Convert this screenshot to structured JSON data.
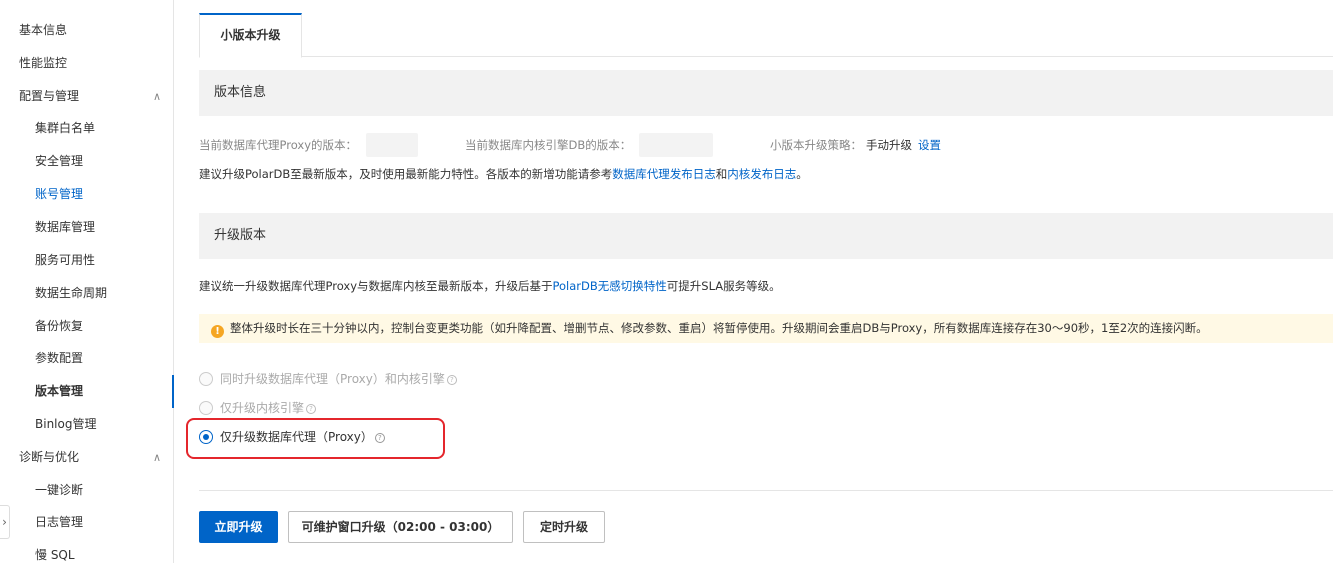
{
  "sidebar": {
    "items": [
      {
        "label": "基本信息",
        "level": "top"
      },
      {
        "label": "性能监控",
        "level": "top"
      },
      {
        "label": "配置与管理",
        "level": "top",
        "expanded": true
      },
      {
        "label": "集群白名单",
        "level": "sub"
      },
      {
        "label": "安全管理",
        "level": "sub"
      },
      {
        "label": "账号管理",
        "level": "sub"
      },
      {
        "label": "数据库管理",
        "level": "sub"
      },
      {
        "label": "服务可用性",
        "level": "sub"
      },
      {
        "label": "数据生命周期",
        "level": "sub"
      },
      {
        "label": "备份恢复",
        "level": "sub"
      },
      {
        "label": "参数配置",
        "level": "sub"
      },
      {
        "label": "版本管理",
        "level": "sub",
        "selected": true
      },
      {
        "label": "Binlog管理",
        "level": "sub"
      },
      {
        "label": "诊断与优化",
        "level": "top",
        "expanded": true
      },
      {
        "label": "一键诊断",
        "level": "sub"
      },
      {
        "label": "日志管理",
        "level": "sub"
      },
      {
        "label": "慢 SQL",
        "level": "sub"
      }
    ],
    "chevron": "∧",
    "collapse_glyph": "›"
  },
  "tabs": [
    {
      "label": "小版本升级",
      "active": true
    }
  ],
  "version_info": {
    "title": "版本信息",
    "proxy_version_label": "当前数据库代理Proxy的版本：",
    "db_version_label": "当前数据库内核引擎DB的版本：",
    "strategy_label": "小版本升级策略：",
    "strategy_value": "手动升级",
    "strategy_link": "设置",
    "advice_prefix": "建议升级PolarDB至最新版本，及时使用最新能力特性。各版本的新增功能请参考",
    "advice_link1": "数据库代理发布日志",
    "advice_and": "和",
    "advice_link2": "内核发布日志",
    "advice_suffix": "。"
  },
  "upgrade": {
    "title": "升级版本",
    "desc_prefix": "建议统一升级数据库代理Proxy与数据库内核至最新版本，升级后基于",
    "desc_link": "PolarDB无感切换特性",
    "desc_suffix": "可提升SLA服务等级。",
    "notice": "整体升级时长在三十分钟以内，控制台变更类功能（如升降配置、增删节点、修改参数、重启）将暂停使用。升级期间会重启DB与Proxy，所有数据库连接存在30～90秒，1至2次的连接闪断。",
    "notice_icon": "!",
    "help_glyph": "?",
    "options": [
      {
        "label": "同时升级数据库代理（Proxy）和内核引擎",
        "disabled": true,
        "checked": false
      },
      {
        "label": "仅升级内核引擎",
        "disabled": true,
        "checked": false
      },
      {
        "label": "仅升级数据库代理（Proxy）",
        "disabled": false,
        "checked": true
      }
    ]
  },
  "buttons": {
    "upgrade_now": "立即升级",
    "maintenance_window": "可维护窗口升级（02:00 - 03:00）",
    "scheduled": "定时升级"
  },
  "colors": {
    "accent": "#0064c8",
    "highlight": "#e4262c",
    "notice_bg": "#fff9e5",
    "warn": "#f5a623"
  }
}
